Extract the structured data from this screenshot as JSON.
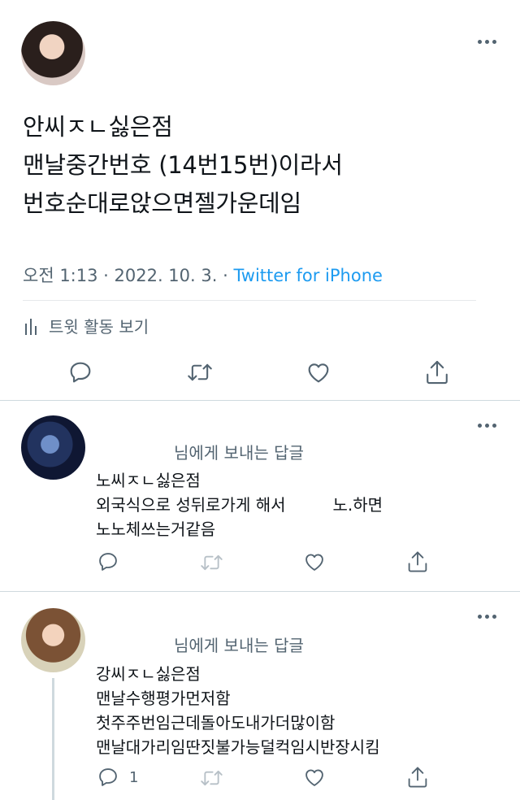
{
  "main_tweet": {
    "lines": [
      "안씨ㅈㄴ싫은점",
      "맨날중간번호 (14번15번)이라서",
      "번호순대로앉으면젤가운데임"
    ],
    "timestamp": "오전 1:13 · 2022. 10. 3. · ",
    "source": "Twitter for iPhone",
    "activity_label": "트윗 활동 보기"
  },
  "replies": [
    {
      "reply_to": "님에게 보내는 답글",
      "lines": [
        "노씨ㅈㄴ싫은점",
        "외국식으로 성뒤로가게 해서",
        "노.하면",
        "노노체쓰는거같음"
      ],
      "reply_count": ""
    },
    {
      "reply_to": "님에게 보내는 답글",
      "lines": [
        "강씨ㅈㄴ싫은점",
        "맨날수행평가먼저함",
        "첫주주번임근데돌아도내가더많이함",
        "맨날대가리임딴짓불가능덜컥임시반장시킴"
      ],
      "reply_count": "1"
    }
  ],
  "colors": {
    "accent": "#1d9bf0",
    "secondary_text": "#536471",
    "primary_text": "#0f1419",
    "divider": "#e6e9eb"
  }
}
